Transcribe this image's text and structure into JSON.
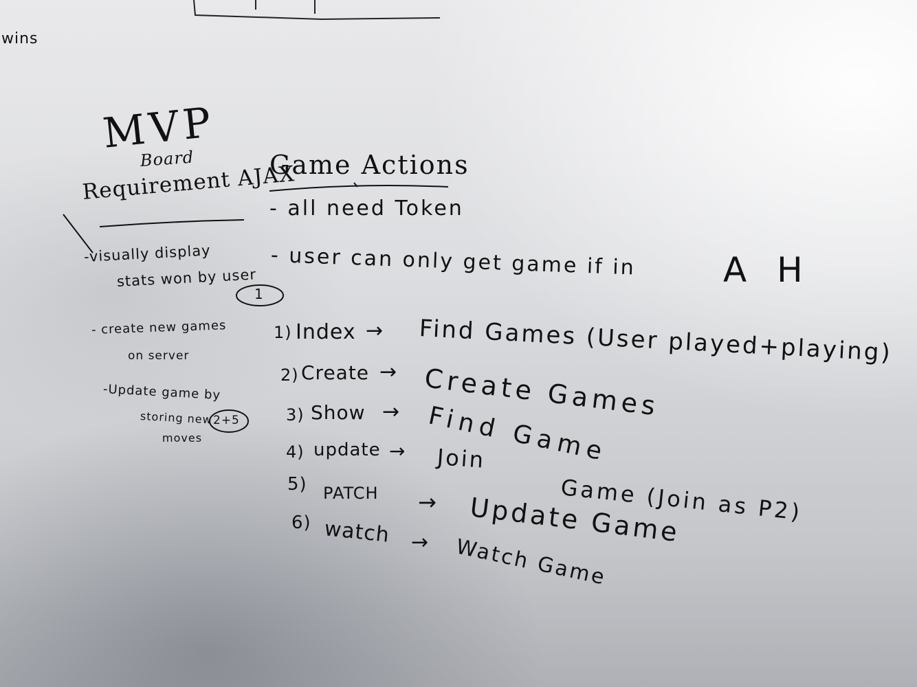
{
  "left_notes": {
    "wins": "wins",
    "mvp": "MVP",
    "board": "Board",
    "requirement": "Requirement AJAX",
    "req1_line1": "-visually display",
    "req1_line2": "stats won by user",
    "req1_badge": "1",
    "req2_line1": "- create new games",
    "req2_line2": "on server",
    "req3_line1": "-Update game by",
    "req3_line2": "storing new",
    "req3_badge": "2+5",
    "req3_line3": "moves"
  },
  "game_actions": {
    "title": "Game Actions",
    "note1": "- all need Token",
    "note2": "- user can only get game if in",
    "note2_tail": "A  H",
    "items": [
      {
        "num": "1)",
        "method": "Index",
        "arrow": "→",
        "action": "Find Games (User played+playing)"
      },
      {
        "num": "2)",
        "method": "Create",
        "arrow": "→",
        "action": "Create Games"
      },
      {
        "num": "3)",
        "method": "Show",
        "arrow": "→",
        "action": "Find Game"
      },
      {
        "num": "4)",
        "method": "update",
        "arrow": "→",
        "action": "Join",
        "action2": "Game (Join as P2)"
      },
      {
        "num": "5)",
        "method": "PATCH",
        "arrow": "→",
        "action": "Update Game"
      },
      {
        "num": "6)",
        "method": "watch",
        "arrow": "→",
        "action": "Watch Game"
      }
    ]
  },
  "colors": {
    "ink": "#111111",
    "board": "#dcdde0"
  }
}
